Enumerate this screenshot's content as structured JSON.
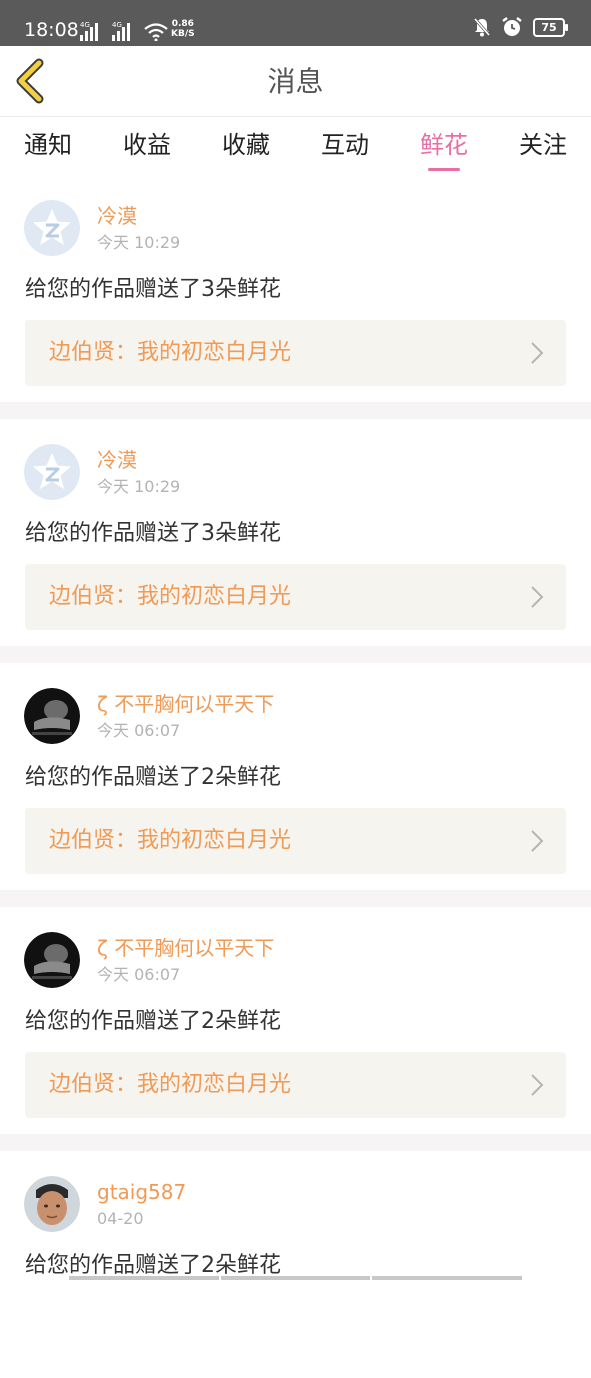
{
  "status_bar": {
    "time": "18:08",
    "signal_1_label": "4G",
    "signal_2_label": "4G",
    "speed_value": "0.86",
    "speed_unit": "KB/S",
    "battery": "75"
  },
  "header": {
    "title": "消息",
    "back_icon": "chevron-left-icon"
  },
  "tabs": [
    {
      "label": "通知",
      "active": false
    },
    {
      "label": "收益",
      "active": false
    },
    {
      "label": "收藏",
      "active": false
    },
    {
      "label": "互动",
      "active": false
    },
    {
      "label": "鲜花",
      "active": true
    },
    {
      "label": "关注",
      "active": false
    }
  ],
  "messages": [
    {
      "user": "冷漠",
      "time": "今天 10:29",
      "text": "给您的作品赠送了3朵鲜花",
      "work": "边伯贤：我的初恋白月光",
      "avatar": "default-star-avatar"
    },
    {
      "user": "冷漠",
      "time": "今天 10:29",
      "text": "给您的作品赠送了3朵鲜花",
      "work": "边伯贤：我的初恋白月光",
      "avatar": "default-star-avatar"
    },
    {
      "user": "ζ 不平胸何以平天下",
      "time": "今天 06:07",
      "text": "给您的作品赠送了2朵鲜花",
      "work": "边伯贤：我的初恋白月光",
      "avatar": "dark-photo-avatar"
    },
    {
      "user": "ζ 不平胸何以平天下",
      "time": "今天 06:07",
      "text": "给您的作品赠送了2朵鲜花",
      "work": "边伯贤：我的初恋白月光",
      "avatar": "dark-photo-avatar"
    },
    {
      "user": "gtaig587",
      "time": "04-20",
      "text": "给您的作品赠送了2朵鲜花",
      "work": "",
      "avatar": "face-photo-avatar"
    }
  ],
  "colors": {
    "accent_pink": "#e86fa6",
    "username_orange": "#f09a56",
    "back_arrow_yellow": "#f2cf43",
    "work_card_bg": "#f5f4ee",
    "separator": "#f7f4f5"
  }
}
